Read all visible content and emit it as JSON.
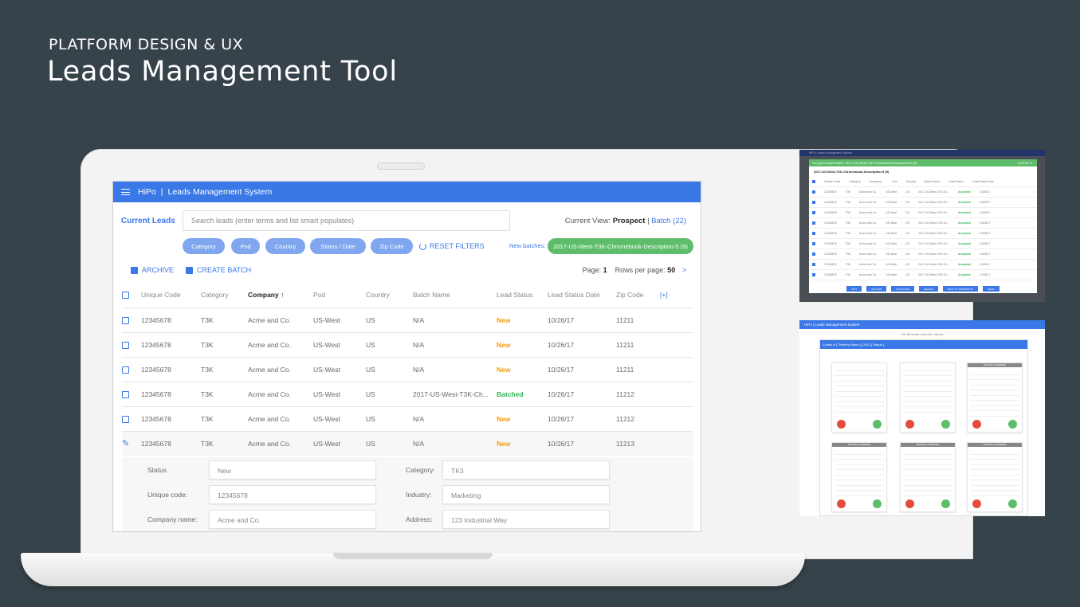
{
  "page": {
    "kicker": "PLATFORM DESIGN & UX",
    "headline": "Leads Management Tool"
  },
  "app": {
    "brand": "HiPo",
    "title": "Leads Management System",
    "current_leads": "Current Leads",
    "search_placeholder": "Search leads (enter terms and list smart populates)",
    "current_view_label": "Current View:",
    "current_view_value": "Prospect",
    "batch_link": "Batch (22)",
    "filters": [
      "Category",
      "Pod",
      "Country",
      "Status  /  Date",
      "Zip Code"
    ],
    "reset_filters": "RESET FILTERS",
    "new_batches_label": "New batches:",
    "new_batch_chip": "2017-US-West-T3K-Chromebook-Description-5 (9)",
    "archive": "ARCHIVE",
    "create_batch": "CREATE BATCH",
    "page_label": "Page:",
    "page_value": "1",
    "rows_label": "Rows per page:",
    "rows_value": "50",
    "next": ">"
  },
  "table": {
    "headers": [
      "Unique Code",
      "Category",
      "Company",
      "Pod",
      "Country",
      "Batch Name",
      "Lead Status",
      "Lead Status Date",
      "Zip Code",
      "[+]"
    ],
    "sort_arrow": "↑",
    "rows": [
      [
        "12345678",
        "T3K",
        "Acme and Co.",
        "US-West",
        "US",
        "N/A",
        "New",
        "10/26/17",
        "11211"
      ],
      [
        "12345678",
        "T3K",
        "Acme and Co.",
        "US-West",
        "US",
        "N/A",
        "New",
        "10/26/17",
        "11211"
      ],
      [
        "12345678",
        "T3K",
        "Acme and Co.",
        "US-West",
        "US",
        "N/A",
        "New",
        "10/26/17",
        "11211"
      ],
      [
        "12345678",
        "T3K",
        "Acme and Co.",
        "US-West",
        "US",
        "2017-US-West-T3K-Ch...",
        "Batched",
        "10/26/17",
        "11212"
      ],
      [
        "12345678",
        "T3K",
        "Acme and Co.",
        "US-West",
        "US",
        "N/A",
        "New",
        "10/26/17",
        "11212"
      ],
      [
        "12345678",
        "T3K",
        "Acme and Co.",
        "US-West",
        "US",
        "N/A",
        "New",
        "10/26/17",
        "11213"
      ]
    ]
  },
  "detail": {
    "status_label": "Status",
    "status_value": "New",
    "unique_code_label": "Unique code:",
    "unique_code_value": "12345678",
    "company_name_label": "Company name:",
    "company_name_value": "Acme and Co.",
    "category_label": "Category:",
    "category_value": "TK3",
    "industry_label": "Industry:",
    "industry_value": "Marketing",
    "address_label": "Address:",
    "address_value": "123 Industrial Way"
  },
  "thumb1": {
    "appbar": "HiPo  |  Leads Management System",
    "banner": "You just created batch: 2017-US-West-T3K-Chromebook-Description-5 (9)",
    "close": "CLOSE ✕",
    "title": "2017-US-West-T3K-Chromebook-Description-5 (9)",
    "headers": [
      "Unique Code",
      "Category",
      "Company ↑",
      "Pod",
      "Country",
      "Batch Name",
      "Lead Status",
      "Lead Status Date"
    ],
    "row": [
      "12345678",
      "T3K",
      "Acme and Co.",
      "US-West",
      "US",
      "2017-US-West-T3K-Ch...",
      "Accepted",
      "10/26/17"
    ],
    "buttons": [
      "EXIT",
      "ARCHIVE",
      "DUPLICATE",
      "DELETE",
      "BACK TO PROSPECTS",
      "SEND"
    ]
  },
  "thumb2": {
    "appbar": "HiPo  |  Leads Management System",
    "sub": "Roll 88 results  |  View All  |  Hold (6)",
    "panel_head": "Leads in [ Territory Name ] [ 250 ] [ Status ]",
    "card_labels": [
      "",
      "",
      "REVIEW OVERRIDE",
      "REVIEW OVERRIDE",
      "REVIEW OVERRIDE",
      "REVIEW OVERRIDE"
    ],
    "reject": "Reject",
    "accept": "Accept"
  },
  "colors": {
    "brand": "#3b78e7",
    "new": "#f59b0d",
    "batched": "#30b350",
    "batch_chip": "#5ebd6a",
    "background": "#37434a"
  }
}
